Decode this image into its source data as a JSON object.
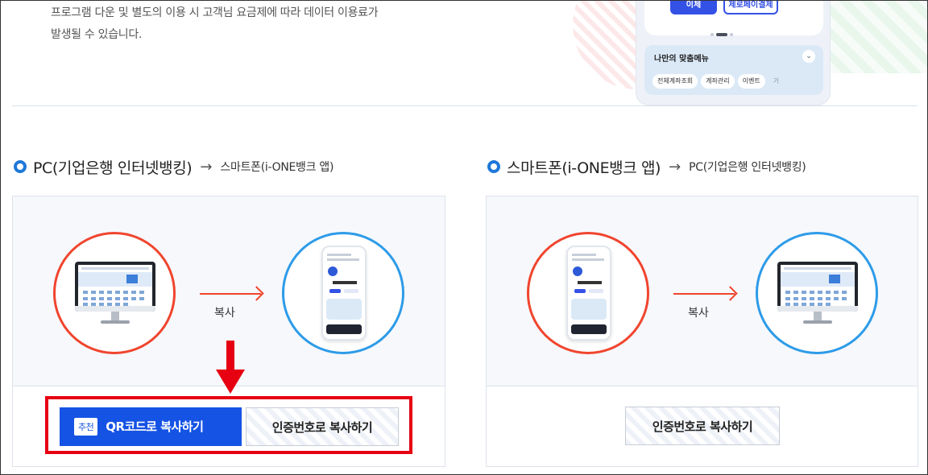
{
  "notice": {
    "line1": "프로그램 다운 및 별도의 이용 시 고객님 요금제에 따라 데이터 이용료가",
    "line2": "발생될 수 있습니다."
  },
  "phone_mockup": {
    "transfer_button": "이체",
    "zeropay_button": "제로페이결제",
    "menu_title": "나만의 맞춤메뉴",
    "chips": [
      "전체계좌조회",
      "계좌관리",
      "이벤트",
      "거"
    ]
  },
  "section_pc_to_phone": {
    "source": "PC(기업은행 인터넷뱅킹)",
    "arrow": "→",
    "target": "스마트폰(i-ONE뱅크 앱)",
    "copy_label": "복사",
    "qr_tag": "추천",
    "qr_button": "QR코드로 복사하기",
    "cert_button": "인증번호로 복사하기"
  },
  "section_phone_to_pc": {
    "source": "스마트폰(i-ONE뱅크 앱)",
    "arrow": "→",
    "target": "PC(기업은행 인터넷뱅킹)",
    "copy_label": "복사",
    "cert_button": "인증번호로 복사하기"
  },
  "colors": {
    "primary": "#1553e4",
    "highlight_red": "#e60012",
    "circle_red": "#f0452e",
    "circle_blue": "#2d9be8"
  },
  "icons": [
    "monitor-icon",
    "smartphone-icon",
    "arrow-right-icon",
    "down-arrow-icon",
    "bullet-icon"
  ]
}
